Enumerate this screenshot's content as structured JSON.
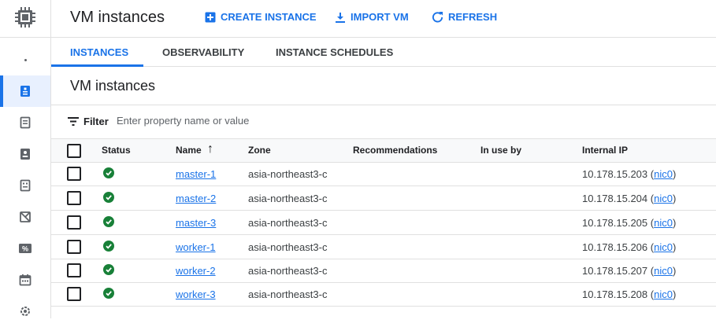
{
  "header": {
    "title": "VM instances",
    "actions": [
      {
        "label": "CREATE INSTANCE",
        "icon": "add-box-icon"
      },
      {
        "label": "IMPORT VM",
        "icon": "download-icon"
      },
      {
        "label": "REFRESH",
        "icon": "refresh-icon"
      }
    ]
  },
  "tabs": [
    {
      "label": "INSTANCES",
      "active": true
    },
    {
      "label": "OBSERVABILITY",
      "active": false
    },
    {
      "label": "INSTANCE SCHEDULES",
      "active": false
    }
  ],
  "section": {
    "title": "VM instances"
  },
  "filter": {
    "label": "Filter",
    "placeholder": "Enter property name or value"
  },
  "table": {
    "columns": {
      "status": "Status",
      "name": "Name",
      "sort_indicator": "↑",
      "zone": "Zone",
      "recommendations": "Recommendations",
      "in_use_by": "In use by",
      "internal_ip": "Internal IP"
    },
    "rows": [
      {
        "status": "running",
        "name": "master-1",
        "zone": "asia-northeast3-c",
        "ip": "10.178.15.203",
        "nic": "nic0"
      },
      {
        "status": "running",
        "name": "master-2",
        "zone": "asia-northeast3-c",
        "ip": "10.178.15.204",
        "nic": "nic0"
      },
      {
        "status": "running",
        "name": "master-3",
        "zone": "asia-northeast3-c",
        "ip": "10.178.15.205",
        "nic": "nic0"
      },
      {
        "status": "running",
        "name": "worker-1",
        "zone": "asia-northeast3-c",
        "ip": "10.178.15.206",
        "nic": "nic0"
      },
      {
        "status": "running",
        "name": "worker-2",
        "zone": "asia-northeast3-c",
        "ip": "10.178.15.207",
        "nic": "nic0"
      },
      {
        "status": "running",
        "name": "worker-3",
        "zone": "asia-northeast3-c",
        "ip": "10.178.15.208",
        "nic": "nic0"
      }
    ]
  },
  "sidebar": {
    "items": [
      {
        "icon": "dot-icon"
      },
      {
        "icon": "vm-instances-icon",
        "active": true
      },
      {
        "icon": "instance-templates-icon"
      },
      {
        "icon": "sole-tenant-nodes-icon"
      },
      {
        "icon": "machine-images-icon"
      },
      {
        "icon": "tpus-icon"
      },
      {
        "icon": "committed-use-discounts-icon"
      },
      {
        "icon": "reservations-icon"
      },
      {
        "icon": "settings-icon"
      }
    ]
  },
  "colors": {
    "accent": "#1a73e8",
    "status_ok": "#188038",
    "active_bg": "#e8f0fe",
    "border": "#e0e0e0",
    "header_bg": "#f8f9fa"
  }
}
